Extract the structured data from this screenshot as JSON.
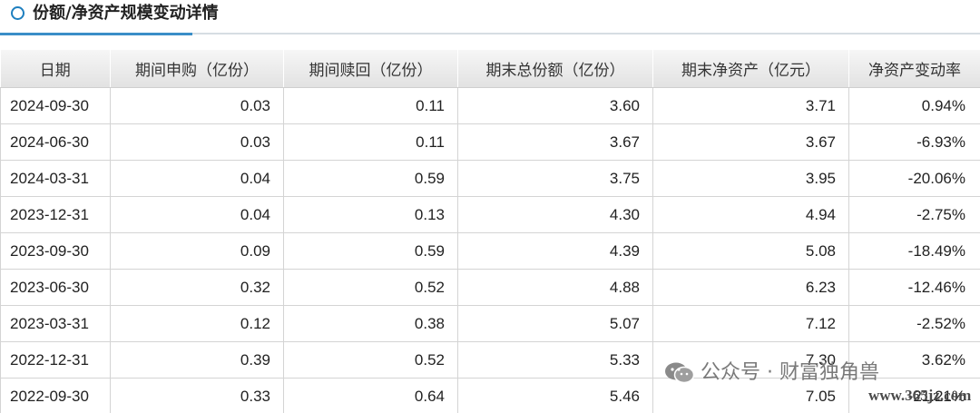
{
  "section": {
    "title": "份额/净资产规模变动详情"
  },
  "chart_data": {
    "type": "table",
    "columns": [
      "日期",
      "期间申购（亿份）",
      "期间赎回（亿份）",
      "期末总份额（亿份）",
      "期末净资产（亿元）",
      "净资产变动率"
    ],
    "rows": [
      [
        "2024-09-30",
        "0.03",
        "0.11",
        "3.60",
        "3.71",
        "0.94%"
      ],
      [
        "2024-06-30",
        "0.03",
        "0.11",
        "3.67",
        "3.67",
        "-6.93%"
      ],
      [
        "2024-03-31",
        "0.04",
        "0.59",
        "3.75",
        "3.95",
        "-20.06%"
      ],
      [
        "2023-12-31",
        "0.04",
        "0.13",
        "4.30",
        "4.94",
        "-2.75%"
      ],
      [
        "2023-09-30",
        "0.09",
        "0.59",
        "4.39",
        "5.08",
        "-18.49%"
      ],
      [
        "2023-06-30",
        "0.32",
        "0.52",
        "4.88",
        "6.23",
        "-12.46%"
      ],
      [
        "2023-03-31",
        "0.12",
        "0.38",
        "5.07",
        "7.12",
        "-2.52%"
      ],
      [
        "2022-12-31",
        "0.39",
        "0.52",
        "5.33",
        "7.30",
        "3.62%"
      ],
      [
        "2022-09-30",
        "0.33",
        "0.64",
        "5.46",
        "7.05",
        "-21.21%"
      ]
    ]
  },
  "watermark": {
    "text": "公众号 · 财富独角兽",
    "site": "www.365jz.com",
    "icon": "wechat-icon"
  },
  "colors": {
    "accent": "#3a8ec8",
    "header_bg": "#e8e8e8"
  }
}
